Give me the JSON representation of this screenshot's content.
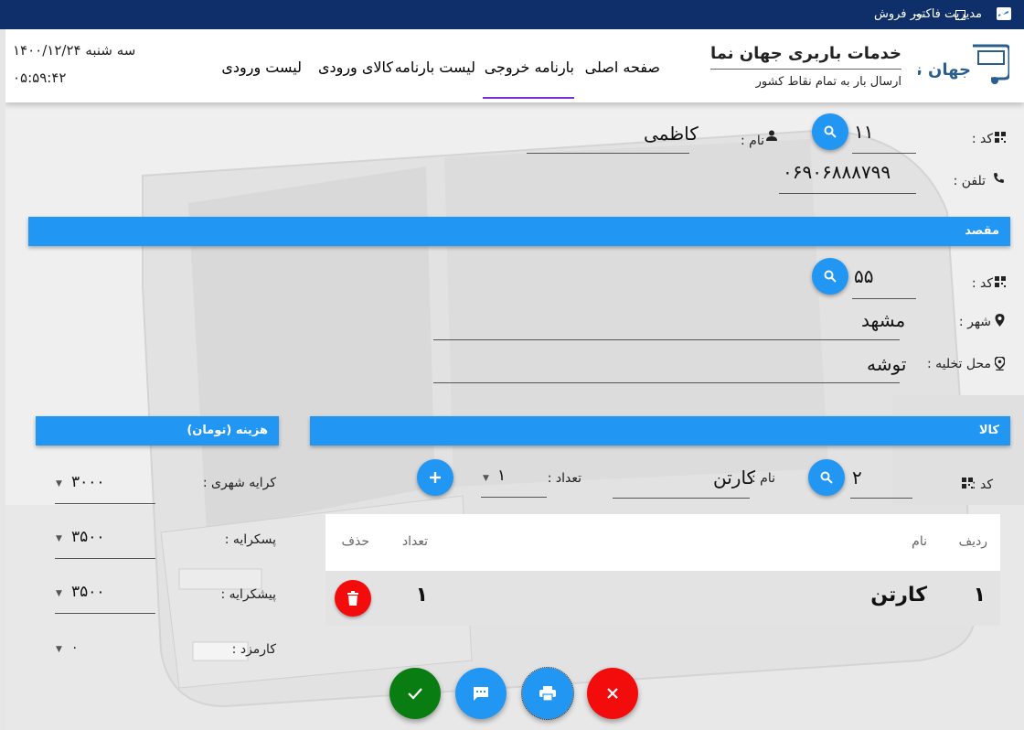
{
  "window": {
    "title": "مدیریت فاکتور فروش"
  },
  "header": {
    "company_name": "خدمات باربری جهان نما",
    "company_sub": "ارسال بار به تمام نقاط کشور",
    "logo_text": "جهان نما",
    "nav": [
      {
        "label": "صفحه اصلی",
        "active": false
      },
      {
        "label": "بارنامه خروجی",
        "active": true
      },
      {
        "label": "لیست بارنامه",
        "active": false
      },
      {
        "label": "کالای ورودی",
        "active": false
      },
      {
        "label": "لیست ورودی",
        "active": false
      }
    ],
    "date": "سه شنبه ۱۴۰۰/۱۲/۲۴",
    "time": "۰۵:۵۹:۴۲"
  },
  "sender": {
    "code_label": "کد :",
    "code_value": "۱۱",
    "name_label": "نام :",
    "name_value": "کاظمی",
    "phone_label": "تلفن :",
    "phone_value": "۰۶۹۰۶۸۸۸۷۹۹"
  },
  "destination": {
    "section_title": "مقصد",
    "code_label": "کد :",
    "code_value": "۵۵",
    "city_label": "شهر :",
    "city_value": "مشهد",
    "unload_label": "محل تخلیه :",
    "unload_value": "توشه"
  },
  "goods": {
    "section_title": "کالا",
    "code_label": "کد :",
    "code_value": "۲",
    "name_label": "نام :",
    "name_value": "کارتن",
    "count_label": "تعداد :",
    "count_value": "۱",
    "table": {
      "headers": {
        "row": "ردیف",
        "name": "نام",
        "count": "تعداد",
        "delete": "حذف"
      },
      "rows": [
        {
          "row": "۱",
          "name": "کارتن",
          "count": "۱"
        }
      ]
    }
  },
  "cost": {
    "section_title": "هزینه (تومان)",
    "items": [
      {
        "label": "کرایه شهری :",
        "value": "۳۰۰۰"
      },
      {
        "label": "پسکرایه :",
        "value": "۳۵۰۰"
      },
      {
        "label": "پیشکرایه :",
        "value": "۳۵۰۰"
      },
      {
        "label": "کارمزد :",
        "value": "۰"
      }
    ]
  },
  "colors": {
    "accent": "#2196f3",
    "confirm": "#0a7d12",
    "cancel": "#f20c0c",
    "nav_indicator": "#7b2fd6",
    "titlebar": "#0f2f6b"
  }
}
